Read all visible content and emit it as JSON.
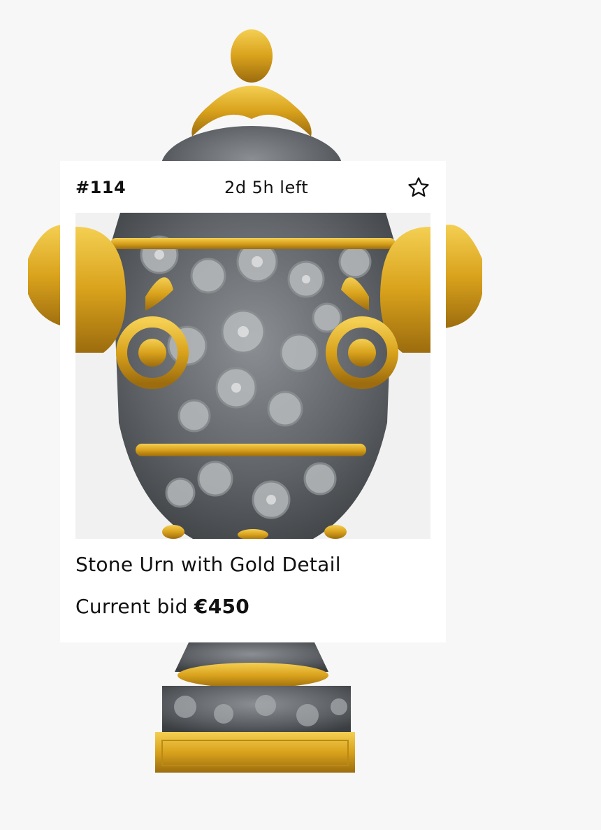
{
  "lot": {
    "number": "#114",
    "time_left": "2d 5h left",
    "title": "Stone Urn with Gold Detail",
    "bid_label": "Current bid ",
    "bid_amount": "€450"
  },
  "icons": {
    "favorite": "star-outline-icon"
  },
  "colors": {
    "gold": "#d9a21c",
    "stone": "#6e7276",
    "card": "#ffffff",
    "text": "#111111"
  }
}
